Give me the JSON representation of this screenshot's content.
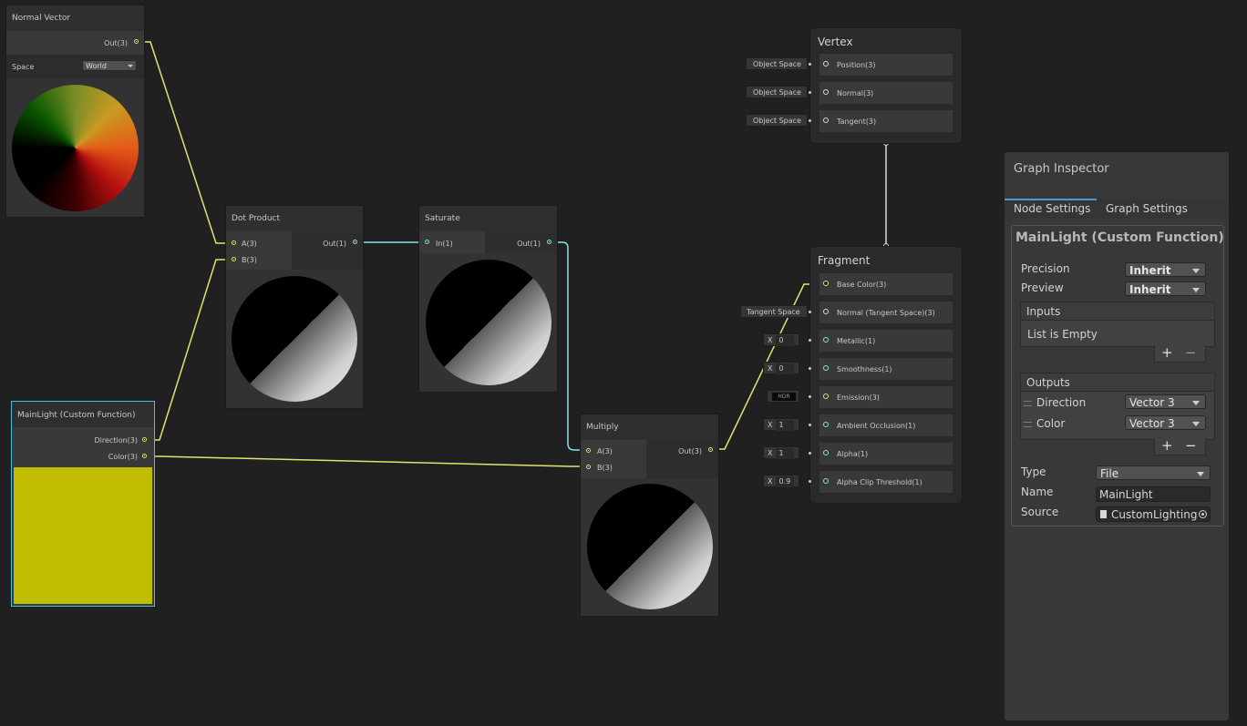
{
  "nodes": {
    "normal_vector": {
      "title": "Normal Vector",
      "out_label": "Out(3)",
      "space_label": "Space",
      "space_value": "World"
    },
    "dot_product": {
      "title": "Dot Product",
      "in_a": "A(3)",
      "in_b": "B(3)",
      "out_label": "Out(1)"
    },
    "saturate": {
      "title": "Saturate",
      "in_label": "In(1)",
      "out_label": "Out(1)"
    },
    "mainlight": {
      "title": "MainLight (Custom Function)",
      "out_direction": "Direction(3)",
      "out_color": "Color(3)"
    },
    "multiply": {
      "title": "Multiply",
      "in_a": "A(3)",
      "in_b": "B(3)",
      "out_label": "Out(3)"
    }
  },
  "vertex": {
    "title": "Vertex",
    "slots": [
      {
        "label": "Position(3)",
        "input": "Object Space"
      },
      {
        "label": "Normal(3)",
        "input": "Object Space"
      },
      {
        "label": "Tangent(3)",
        "input": "Object Space"
      }
    ]
  },
  "fragment": {
    "title": "Fragment",
    "slots": [
      {
        "label": "Base Color(3)",
        "input": ""
      },
      {
        "label": "Normal (Tangent Space)(3)",
        "input": "Tangent Space"
      },
      {
        "label": "Metallic(1)",
        "x": "X",
        "value": "0"
      },
      {
        "label": "Smoothness(1)",
        "x": "X",
        "value": "0"
      },
      {
        "label": "Emission(3)",
        "input": "HDR"
      },
      {
        "label": "Ambient Occlusion(1)",
        "x": "X",
        "value": "1"
      },
      {
        "label": "Alpha(1)",
        "x": "X",
        "value": "1"
      },
      {
        "label": "Alpha Clip Threshold(1)",
        "x": "X",
        "value": "0.9"
      }
    ]
  },
  "inspector": {
    "title": "Graph Inspector",
    "tabs": [
      "Node Settings",
      "Graph Settings"
    ],
    "node_header": "MainLight (Custom Function) Node",
    "precision_label": "Precision",
    "precision_value": "Inherit",
    "preview_label": "Preview",
    "preview_value": "Inherit",
    "inputs_label": "Inputs",
    "inputs_empty": "List is Empty",
    "outputs_label": "Outputs",
    "outputs": [
      {
        "name": "Direction",
        "type": "Vector 3"
      },
      {
        "name": "Color",
        "type": "Vector 3"
      }
    ],
    "plus": "+",
    "minus": "−",
    "type_label": "Type",
    "type_value": "File",
    "name_label": "Name",
    "name_value": "MainLight",
    "source_label": "Source",
    "source_value": "CustomLighting"
  },
  "colors": {
    "wire_vec3": "#e3e36a",
    "wire_vec1": "#84e4e7",
    "wire_white": "#dcdcdc",
    "selection": "#44c0e6",
    "mainlight_preview": "#c0bd00",
    "background": "#202020"
  }
}
